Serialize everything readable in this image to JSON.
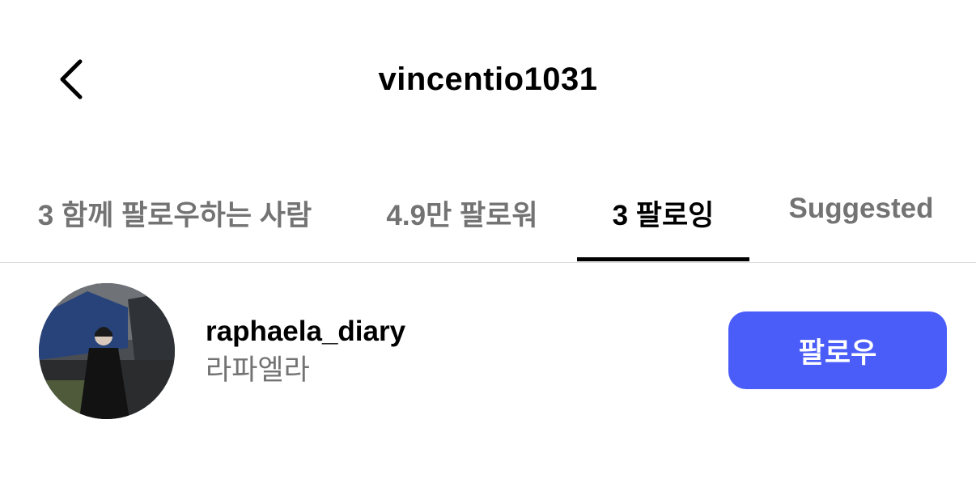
{
  "header": {
    "title": "vincentio1031",
    "back_icon": "chevron-left-icon"
  },
  "tabs": [
    {
      "label": "3 함께 팔로우하는 사람",
      "active": false
    },
    {
      "label": "4.9만 팔로워",
      "active": false
    },
    {
      "label": "3 팔로잉",
      "active": true
    },
    {
      "label": "Suggested",
      "active": false
    }
  ],
  "users": [
    {
      "username": "raphaela_diary",
      "full_name": "라파엘라",
      "follow_label": "팔로우"
    }
  ],
  "colors": {
    "accent": "#4a5df9",
    "secondary_text": "#737373",
    "divider": "#dbdbdb"
  }
}
